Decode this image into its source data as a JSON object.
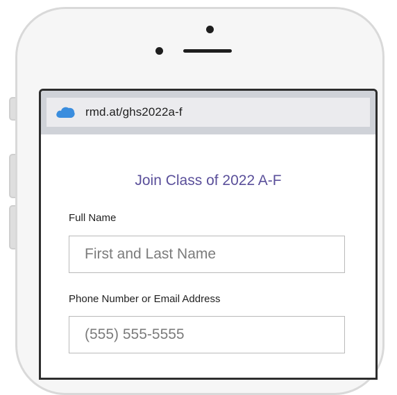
{
  "browser": {
    "url": "rmd.at/ghs2022a-f",
    "icon": "cloud-icon",
    "icon_color": "#3a8dde"
  },
  "form": {
    "title": "Join Class of 2022 A-F",
    "title_color": "#5a4f9a",
    "fields": [
      {
        "label": "Full Name",
        "placeholder": "First and Last Name"
      },
      {
        "label": "Phone Number or Email Address",
        "placeholder": "(555) 555-5555"
      }
    ]
  }
}
